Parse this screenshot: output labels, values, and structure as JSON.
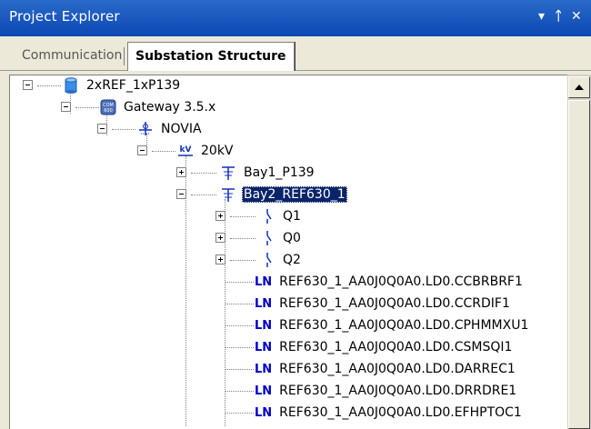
{
  "window": {
    "title": "Project Explorer",
    "pin_glyph": "▾ ⊥ ✕"
  },
  "tabs": [
    {
      "label": "Communication",
      "active": false
    },
    {
      "label": "Substation Structure",
      "active": true
    }
  ],
  "tree": {
    "root": {
      "label": "2xREF_1xP139",
      "icon": "database-icon"
    },
    "gateway": {
      "label": "Gateway 3.5.x",
      "icon": "gateway-icon"
    },
    "substation": {
      "label": "NOVIA",
      "icon": "substation-icon"
    },
    "voltage": {
      "label": "20kV",
      "icon": "voltage-level-icon"
    },
    "bays": [
      {
        "label": "Bay1_P139",
        "icon": "bay-icon",
        "selected": false
      },
      {
        "label": "Bay2_REF630_1",
        "icon": "bay-icon",
        "selected": true
      }
    ],
    "devices": [
      {
        "label": "Q1",
        "icon": "switch-icon"
      },
      {
        "label": "Q0",
        "icon": "switch-icon"
      },
      {
        "label": "Q2",
        "icon": "switch-icon"
      }
    ],
    "ln_tag": "LN",
    "logical_nodes": [
      "REF630_1_AA0J0Q0A0.LD0.CCBRBRF1",
      "REF630_1_AA0J0Q0A0.LD0.CCRDIF1",
      "REF630_1_AA0J0Q0A0.LD0.CPHMMXU1",
      "REF630_1_AA0J0Q0A0.LD0.CSMSQI1",
      "REF630_1_AA0J0Q0A0.LD0.DARREC1",
      "REF630_1_AA0J0Q0A0.LD0.DRRDRE1",
      "REF630_1_AA0J0Q0A0.LD0.EFHPTOC1"
    ]
  },
  "colors": {
    "titlebar": "#0b48b4",
    "selection": "#0a246a",
    "ln_tag": "#0000c8",
    "panel": "#ece9d8"
  }
}
